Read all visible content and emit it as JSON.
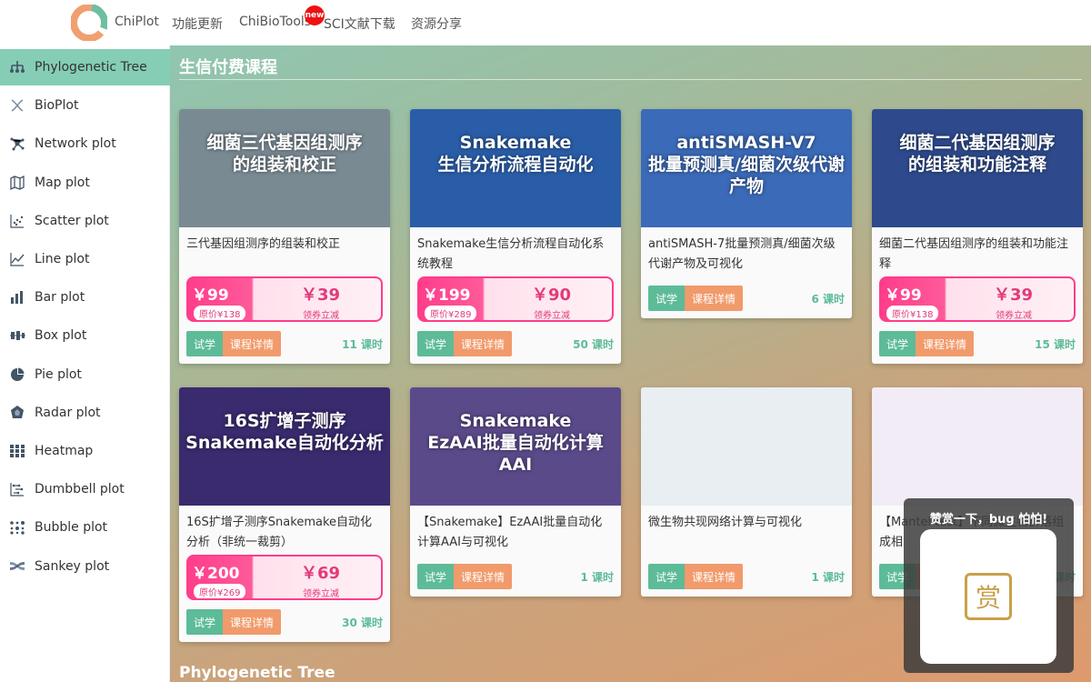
{
  "nav": {
    "items": [
      "ChiPlot",
      "功能更新",
      "ChiBioTools",
      "SCI文献下载",
      "资源分享"
    ],
    "badge": "new"
  },
  "sidebar": {
    "items": [
      {
        "label": "Phylogenetic Tree",
        "icon": "tree-icon"
      },
      {
        "label": "BioPlot",
        "icon": "dna-icon"
      },
      {
        "label": "Network plot",
        "icon": "network-icon"
      },
      {
        "label": "Map plot",
        "icon": "map-icon"
      },
      {
        "label": "Scatter plot",
        "icon": "scatter-icon"
      },
      {
        "label": "Line plot",
        "icon": "line-chart-icon"
      },
      {
        "label": "Bar plot",
        "icon": "bar-chart-icon"
      },
      {
        "label": "Box plot",
        "icon": "box-plot-icon"
      },
      {
        "label": "Pie plot",
        "icon": "pie-chart-icon"
      },
      {
        "label": "Radar plot",
        "icon": "radar-icon"
      },
      {
        "label": "Heatmap",
        "icon": "heatmap-icon"
      },
      {
        "label": "Dumbbell plot",
        "icon": "dumbbell-icon"
      },
      {
        "label": "Bubble plot",
        "icon": "bubble-icon"
      },
      {
        "label": "Sankey plot",
        "icon": "sankey-icon"
      }
    ]
  },
  "main": {
    "section_title": "生信付费课程",
    "next_section_title": "Phylogenetic Tree",
    "try_label": "试学",
    "detail_label": "课程详情",
    "cards": [
      {
        "thumb_text": "细菌三代基因组测序\n的组装和校正",
        "thumb_color": "#7a8a93",
        "title": "三代基因组测序的组装和校正",
        "price": "￥99",
        "orig": "原价¥138",
        "coupon": "￥39",
        "tip": "领券立减",
        "lessons": "11 课时"
      },
      {
        "thumb_text": "Snakemake\n生信分析流程自动化",
        "thumb_color": "#2a5da8",
        "title": "Snakemake生信分析流程自动化系统教程",
        "price": "￥199",
        "orig": "原价¥289",
        "coupon": "￥90",
        "tip": "领券立减",
        "lessons": "50 课时"
      },
      {
        "thumb_text": "antiSMASH-V7\n批量预测真/细菌次级代谢产物",
        "thumb_color": "#3b6ab8",
        "title": "antiSMASH-7批量预测真/细菌次级代谢产物及可视化",
        "lessons": "6 课时"
      },
      {
        "thumb_text": "细菌二代基因组测序\n的组装和功能注释",
        "thumb_color": "#2e4a8c",
        "title": "细菌二代基因组测序的组装和功能注释",
        "price": "￥99",
        "orig": "原价¥138",
        "coupon": "￥39",
        "tip": "领券立减",
        "lessons": "15 课时"
      },
      {
        "thumb_text": "16S扩增子测序\nSnakemake自动化分析",
        "thumb_color": "#3a2a6e",
        "title": "16S扩增子测序Snakemake自动化分析（非统一裁剪）",
        "price": "￥200",
        "orig": "原价¥269",
        "coupon": "￥69",
        "tip": "领券立减",
        "lessons": "30 课时"
      },
      {
        "thumb_text": "Snakemake\nEzAAI批量自动化计算AAI",
        "thumb_color": "#5b4a8a",
        "title": "【Snakemake】EzAAI批量自动化计算AAI与可视化",
        "lessons": "1 课时"
      },
      {
        "thumb_text": "",
        "thumb_color": "#e8eef2",
        "title": "微生物共现网络计算与可视化",
        "lessons": "1 课时"
      },
      {
        "thumb_text": "",
        "thumb_color": "#f1ecf5",
        "title": "【Mantel test】不同微生物群落组成相",
        "lessons": "1 课时"
      }
    ]
  },
  "reward": {
    "text": "赞赏一下，bug 怕怕!",
    "char": "赏"
  }
}
